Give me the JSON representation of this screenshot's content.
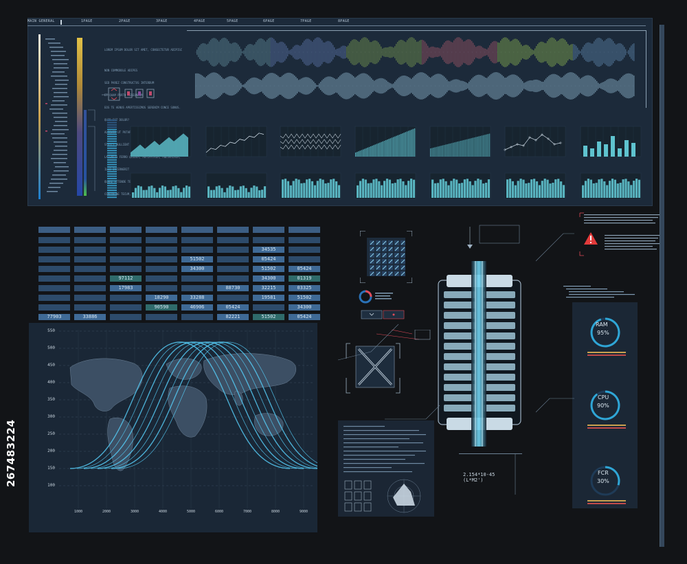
{
  "nav": {
    "items": [
      "MAIN GENERAL",
      "1PAGE",
      "2PAGE",
      "3PAGE",
      "4PAGE",
      "5PAGE",
      "6PAGE",
      "7PAGE",
      "8PAGE"
    ]
  },
  "top_text": {
    "lines": [
      "LOREM IPSUM DOLOR SIT AMET, CONSECTETUR ADIPISC",
      "",
      "NON COMMODOLE ADIPES",
      "SED PAREZ CONSTRUCTUS INTERDUM",
      "ET QUAM PORTO PEREUNDUM",
      "EOS TE AENUS APERTISSIMOS SERENIM CONCE SUNUS.",
      "QUID EST DOLOR?",
      "ALIQUID UT PUTARE DISCENDIS SIT SUPPONERE",
      "STOICI BULLIENT",
      "LACENDAS FERRO QUIDEM, ANTIPATRUM, MNESARCHUM,",
      "ILLE INCERNERIT",
      "QUARE ATTENDE TE STUDIOSE IT, QUACUMQUE RERUS",
      "COMPONUNE TECUM, QUAM LOQUI SOCRA VER ANDITION."
    ]
  },
  "tables": {
    "rows": [
      [
        "",
        "",
        "",
        "",
        "",
        "34535",
        ""
      ],
      [
        "",
        "",
        "",
        "51502",
        "",
        "05424",
        ""
      ],
      [
        "",
        "",
        "",
        "34300",
        "",
        "51502",
        "05424"
      ],
      [
        "",
        "97112",
        "",
        "",
        "",
        "34300",
        "01319"
      ],
      [
        "",
        "17983",
        "",
        "",
        "88730",
        "32215",
        "03325"
      ],
      [
        "",
        "",
        "18290",
        "33288",
        "",
        "19581",
        "51502"
      ],
      [
        "",
        "",
        "90590",
        "46906",
        "05424",
        "",
        "34300"
      ],
      [
        "77903",
        "33886",
        "",
        "",
        "82221",
        "51502",
        "05424"
      ]
    ]
  },
  "map": {
    "y_ticks": [
      "550",
      "500",
      "450",
      "400",
      "350",
      "300",
      "250",
      "200",
      "150",
      "100"
    ],
    "x_ticks": [
      "1000",
      "2000",
      "3000",
      "4000",
      "5000",
      "6000",
      "7000",
      "8000",
      "9000"
    ]
  },
  "gauges": [
    {
      "label": "RAM",
      "value": "95%",
      "fraction": 0.95
    },
    {
      "label": "CPU",
      "value": "90%",
      "fraction": 0.9
    },
    {
      "label": "FCR",
      "value": "30%",
      "fraction": 0.3
    }
  ],
  "readout": {
    "formula": "2.154*10-45",
    "unit": "(L*M2')"
  },
  "stock": {
    "id": "267483224"
  },
  "colors": {
    "accent": "#2fa6d6",
    "bar": "#5fc3cf",
    "warning": "#e23b3b",
    "cell": "#3c5e84"
  }
}
